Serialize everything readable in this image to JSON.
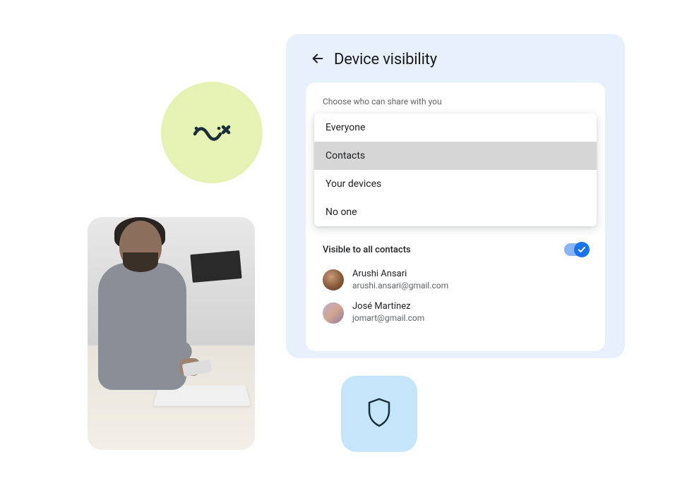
{
  "header": {
    "title": "Device visibility"
  },
  "card": {
    "section_label": "Choose who can share with you",
    "options": {
      "everyone": "Everyone",
      "contacts": "Contacts",
      "your_devices": "Your devices",
      "no_one": "No one"
    },
    "toggle_label": "Visible to all contacts",
    "contacts": [
      {
        "name": "Arushi Ansari",
        "email": "arushi.ansari@gmail.com"
      },
      {
        "name": "José Martínez",
        "email": "jomart@gmail.com"
      }
    ]
  },
  "icons": {
    "decorative_wave": "wave-icon",
    "shield": "shield-icon",
    "back": "arrow-left-icon",
    "check": "check-icon"
  }
}
